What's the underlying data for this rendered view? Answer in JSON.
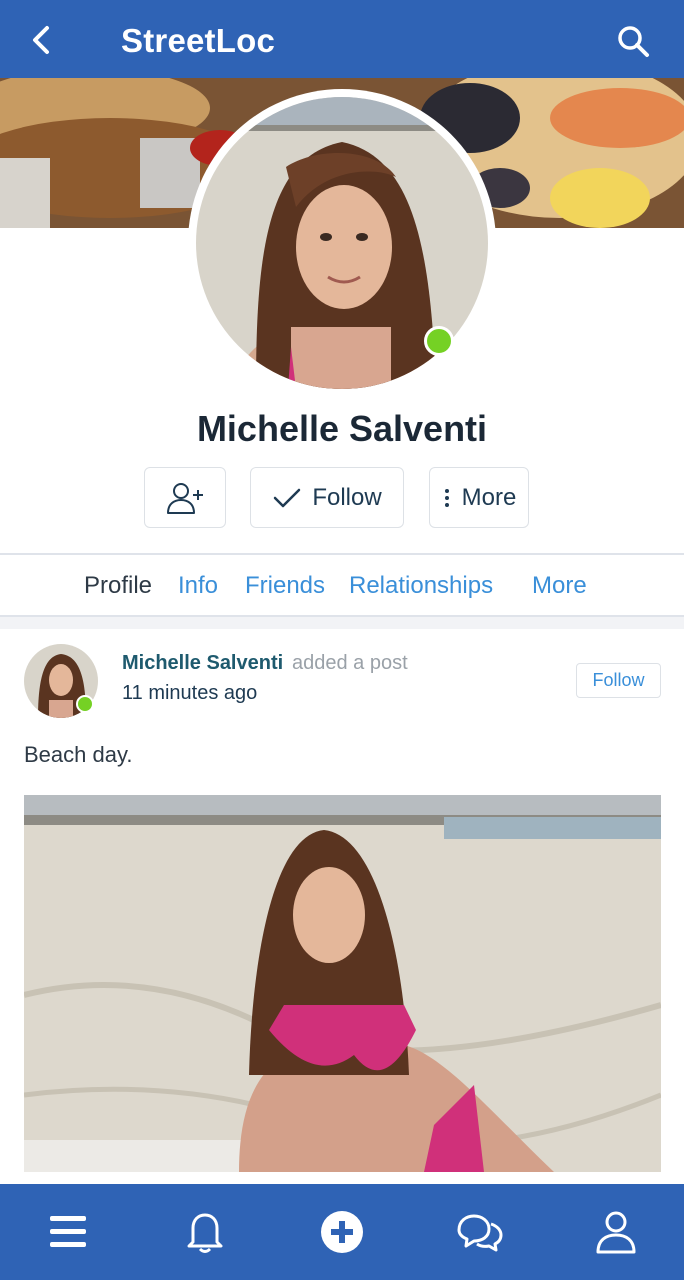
{
  "header": {
    "title": "StreetLoc",
    "back_icon": "chevron-left-icon",
    "search_icon": "search-icon"
  },
  "profile": {
    "name": "Michelle Salventi",
    "online": true,
    "actions": {
      "add_friend_icon": "add-user-icon",
      "follow_label": "Follow",
      "more_label": "More"
    }
  },
  "tabs": [
    {
      "label": "Profile",
      "active": true
    },
    {
      "label": "Info"
    },
    {
      "label": "Friends"
    },
    {
      "label": "Relationships"
    },
    {
      "label": "More"
    }
  ],
  "post": {
    "author": "Michelle Salventi",
    "action": "added a post",
    "time": "11 minutes ago",
    "follow_label": "Follow",
    "text": "Beach day."
  },
  "bottom_nav": [
    "menu-icon",
    "bell-icon",
    "plus-circle-icon",
    "chat-icon",
    "user-icon"
  ],
  "colors": {
    "primary": "#2f63b5",
    "link": "#3a8fd9",
    "online": "#75d124"
  }
}
